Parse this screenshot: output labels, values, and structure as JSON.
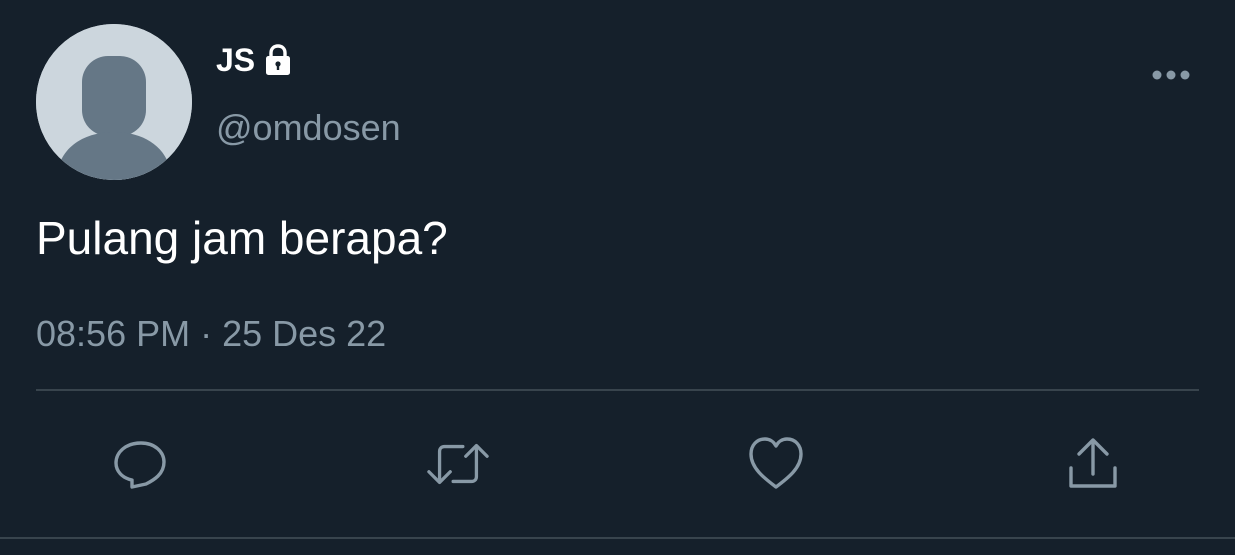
{
  "tweet": {
    "display_name": "JS",
    "handle": "@omdosen",
    "text": "Pulang jam berapa?",
    "timestamp": "08:56 PM · 25 Des 22",
    "protected_icon": "lock-icon",
    "more_icon": "more-horizontal-icon"
  },
  "actions": [
    {
      "name": "reply",
      "icon": "reply-icon"
    },
    {
      "name": "retweet",
      "icon": "retweet-icon"
    },
    {
      "name": "like",
      "icon": "heart-icon"
    },
    {
      "name": "share",
      "icon": "share-icon"
    }
  ],
  "colors": {
    "background": "#15202b",
    "text_primary": "#ffffff",
    "text_secondary": "#8899a6",
    "divider": "#38444d",
    "icon": "#8899a6",
    "avatar_bg": "#ccd6dd",
    "avatar_figure": "#657786"
  }
}
